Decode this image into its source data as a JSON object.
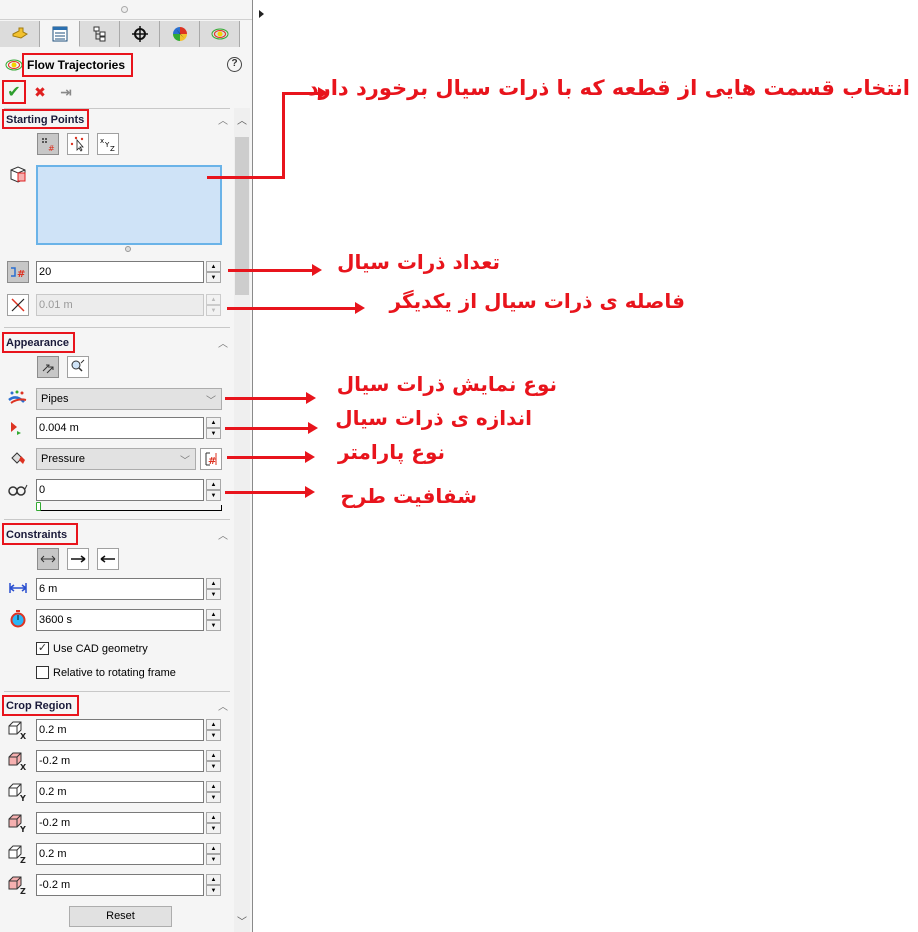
{
  "propertyManager": {
    "title": "Flow Trajectories",
    "help_icon": "?",
    "tabs": [
      {
        "name": "feature-manager",
        "icon": "part-icon"
      },
      {
        "name": "property-manager",
        "icon": "property-list-icon",
        "active": true
      },
      {
        "name": "configuration-manager",
        "icon": "configuration-tree-icon"
      },
      {
        "name": "dimxpert-manager",
        "icon": "crosshair-icon"
      },
      {
        "name": "display-manager",
        "icon": "color-wheel-icon"
      },
      {
        "name": "flow-simulation",
        "icon": "flow-simulation-icon"
      }
    ],
    "actions": {
      "ok": "✔",
      "cancel": "✖",
      "pin": "⇥"
    }
  },
  "starting_points": {
    "header": "Starting Points",
    "number_of_points": "20",
    "spacing": "0.01 m",
    "tools": [
      "pattern-points",
      "pick-points",
      "xyz-coordinates"
    ]
  },
  "appearance": {
    "header": "Appearance",
    "draw_as": "Pipes",
    "width": "0.004 m",
    "color_by": "Pressure",
    "transparency": "0",
    "transparency_slider_value": 0
  },
  "constraints": {
    "header": "Constraints",
    "max_length": "6 m",
    "max_time": "3600 s",
    "use_cad_geometry_label": "Use CAD geometry",
    "use_cad_geometry_checked": true,
    "relative_rotating_label": "Relative to rotating frame",
    "relative_rotating_checked": false
  },
  "crop_region": {
    "header": "Crop Region",
    "fields": [
      {
        "axis": "X",
        "bound": "max",
        "value": "0.2 m"
      },
      {
        "axis": "X",
        "bound": "min",
        "value": "-0.2 m"
      },
      {
        "axis": "Y",
        "bound": "max",
        "value": "0.2 m"
      },
      {
        "axis": "Y",
        "bound": "min",
        "value": "-0.2 m"
      },
      {
        "axis": "Z",
        "bound": "max",
        "value": "0.2 m"
      },
      {
        "axis": "Z",
        "bound": "min",
        "value": "-0.2 m"
      }
    ],
    "reset_label": "Reset"
  },
  "annotations": {
    "selection": "انتخاب قسمت هایی از قطعه که با ذرات سیال برخورد دارد",
    "count": "تعداد ذرات سیال",
    "spacing": "فاصله ی ذرات سیال از یکدیگر",
    "display_type": "نوع نمایش ذرات سیال",
    "size": "اندازه ی ذرات سیال",
    "parameter": "نوع پارامتر",
    "transparency": "شفافیت طرح"
  },
  "colors": {
    "annotation_red": "#e8141c",
    "selection_fill": "#cfe3f7",
    "selection_border": "#6ab3e8"
  }
}
